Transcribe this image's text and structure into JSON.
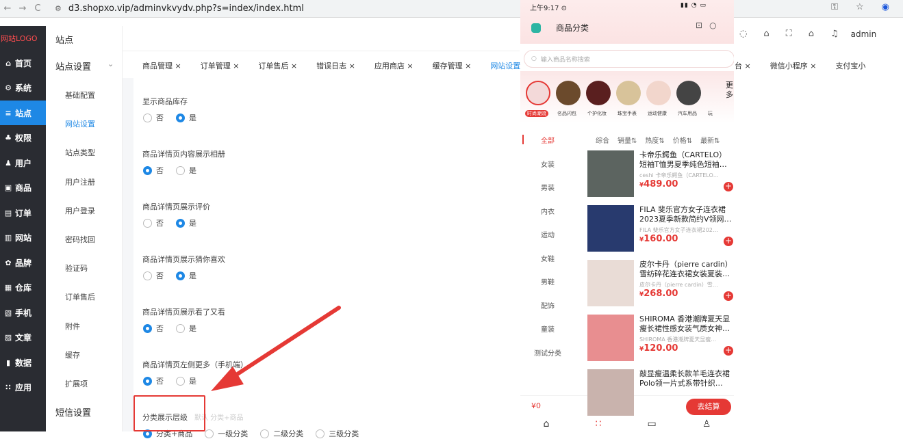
{
  "browser": {
    "url": "d3.shopxo.vip/adminvkvydv.php?s=index/index.html",
    "back": "←",
    "forward": "→",
    "reload": "C",
    "site_icon": "⚙"
  },
  "app": {
    "logo": "网站LOGO",
    "section_title": "站点",
    "admin_label": "admin"
  },
  "sidebar": {
    "items": [
      {
        "label": "首页",
        "icon": "home-icon",
        "glyph": "⌂"
      },
      {
        "label": "系统",
        "icon": "gear-icon",
        "glyph": "⚙"
      },
      {
        "label": "站点",
        "icon": "sliders-icon",
        "glyph": "≡"
      },
      {
        "label": "权限",
        "icon": "key-icon",
        "glyph": "♣"
      },
      {
        "label": "用户",
        "icon": "user-icon",
        "glyph": "♟"
      },
      {
        "label": "商品",
        "icon": "goods-icon",
        "glyph": "▣"
      },
      {
        "label": "订单",
        "icon": "order-icon",
        "glyph": "▤"
      },
      {
        "label": "网站",
        "icon": "site-icon",
        "glyph": "▥"
      },
      {
        "label": "品牌",
        "icon": "brand-icon",
        "glyph": "✿"
      },
      {
        "label": "仓库",
        "icon": "warehouse-icon",
        "glyph": "▦"
      },
      {
        "label": "手机",
        "icon": "phone-icon",
        "glyph": "▧"
      },
      {
        "label": "文章",
        "icon": "article-icon",
        "glyph": "▨"
      },
      {
        "label": "数据",
        "icon": "chart-icon",
        "glyph": "▮"
      },
      {
        "label": "应用",
        "icon": "apps-icon",
        "glyph": "∷"
      }
    ],
    "active_index": 2
  },
  "submenu": {
    "group": "站点设置",
    "chevron": "⌄",
    "items": [
      "基础配置",
      "网站设置",
      "站点类型",
      "用户注册",
      "用户登录",
      "密码找回",
      "验证码",
      "订单售后",
      "附件",
      "缓存",
      "扩展项"
    ],
    "active_index": 1,
    "footer_group": "短信设置"
  },
  "tabs": {
    "left": [
      "商品管理 ×",
      "订单管理 ×",
      "订单售后 ×",
      "错误日志 ×",
      "应用商店 ×",
      "缓存管理 ×",
      "网站设置 ×"
    ],
    "active_index": 6,
    "right": [
      "台 ×",
      "微信小程序 ×",
      "支付宝小"
    ]
  },
  "settings": [
    {
      "label": "显示商品库存",
      "options": [
        "否",
        "是"
      ],
      "selected": 1
    },
    {
      "label": "商品详情页内容展示相册",
      "options": [
        "否",
        "是"
      ],
      "selected": 0
    },
    {
      "label": "商品详情页展示评价",
      "options": [
        "否",
        "是"
      ],
      "selected": 1
    },
    {
      "label": "商品详情页展示猜你喜欢",
      "options": [
        "否",
        "是"
      ],
      "selected": 1
    },
    {
      "label": "商品详情页展示看了又看",
      "options": [
        "否",
        "是"
      ],
      "selected": 0
    },
    {
      "label": "商品详情页左侧更多（手机端）",
      "options": [
        "否",
        "是"
      ],
      "selected": 0
    },
    {
      "label": "分类展示层级",
      "hint": "默认 分类+商品",
      "options": [
        "分类+商品",
        "一级分类",
        "二级分类",
        "三级分类"
      ],
      "selected": 0
    }
  ],
  "phone": {
    "status_time": "上午9:17 ⊙",
    "status_right": "▮▮ ◔ ▭",
    "mini_title": "商品分类",
    "mini_btn1": "⊡",
    "mini_btn2": "○",
    "search_placeholder": "输入商品名称搜索",
    "categories": [
      "时尚潮流",
      "名品闪包",
      "个护化妆",
      "珠宝手表",
      "运动健康",
      "汽车用品",
      "玩"
    ],
    "more_label": "更多",
    "left_menu": [
      "全部",
      "女装",
      "男装",
      "内衣",
      "运动",
      "女鞋",
      "男鞋",
      "配饰",
      "童装",
      "测试分类"
    ],
    "left_active": 0,
    "sort": [
      "综合",
      "销量⇅",
      "热度⇅",
      "价格⇅",
      "最新⇅"
    ],
    "products": [
      {
        "name": "卡帝乐鳄鱼（CARTELO）短袖T恤男夏季纯色短袖…",
        "sub": "ceshi 卡帝乐鳄鱼（CARTELO…",
        "price": "489.00",
        "img_color": "#5c6460"
      },
      {
        "name": "FILA 斐乐官方女子连衣裙2023夏季新款简约V领网…",
        "sub": "FILA 斐乐官方女子连衣裙202…",
        "price": "160.00",
        "img_color": "#283a6e"
      },
      {
        "name": "皮尔卡丹（pierre cardin）雪纺碎花连衣裙女装夏装…",
        "sub": "皮尔卡丹（pierre cardin）雪…",
        "price": "268.00",
        "img_color": "#e9dcd6"
      },
      {
        "name": "SHIROMA 香港潮牌夏天显瘦长裙性感女装气质女神…",
        "sub": "SHIROMA 香港潮牌夏天显瘦…",
        "price": "120.00",
        "img_color": "#e88e90"
      },
      {
        "name": "敲显瘦温柔长款羊毛连衣裙Polo领一片式系带针织…",
        "sub": "",
        "price": "",
        "img_color": "#c9b3ad"
      }
    ],
    "currency": "¥",
    "add": "+",
    "cart_count": "¥0",
    "checkout": "去结算",
    "tabbar": [
      "⌂",
      "∷",
      "▭",
      "♙"
    ]
  },
  "colors": {
    "accent": "#1e88e5",
    "sidebar_bg": "#2a2c32",
    "brand_red": "#e53935"
  }
}
